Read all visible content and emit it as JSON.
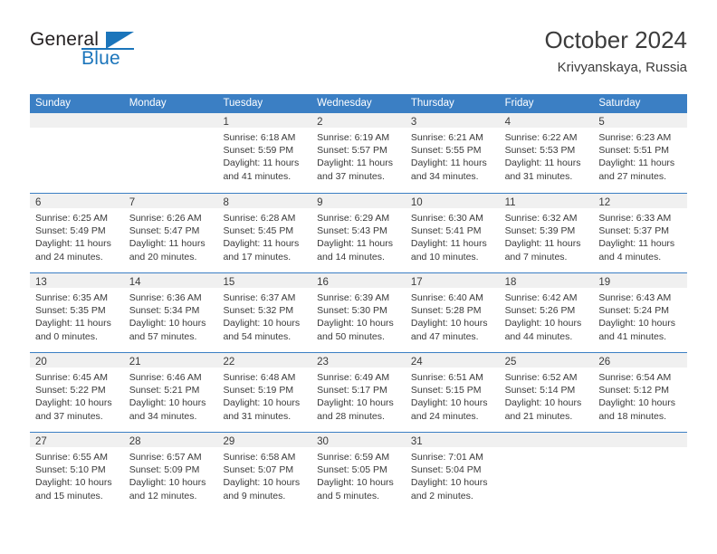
{
  "brand": {
    "line1": "General",
    "line2": "Blue",
    "accent_color": "#1b75bb"
  },
  "header": {
    "title": "October 2024",
    "location": "Krivyanskaya, Russia"
  },
  "calendar": {
    "header_color": "#3b7fc4",
    "daynum_band_color": "#f0f0f0",
    "weekday_headers": [
      "Sunday",
      "Monday",
      "Tuesday",
      "Wednesday",
      "Thursday",
      "Friday",
      "Saturday"
    ],
    "weeks": [
      [
        {
          "day": "",
          "lines": []
        },
        {
          "day": "",
          "lines": []
        },
        {
          "day": "1",
          "lines": [
            "Sunrise: 6:18 AM",
            "Sunset: 5:59 PM",
            "Daylight: 11 hours",
            "and 41 minutes."
          ]
        },
        {
          "day": "2",
          "lines": [
            "Sunrise: 6:19 AM",
            "Sunset: 5:57 PM",
            "Daylight: 11 hours",
            "and 37 minutes."
          ]
        },
        {
          "day": "3",
          "lines": [
            "Sunrise: 6:21 AM",
            "Sunset: 5:55 PM",
            "Daylight: 11 hours",
            "and 34 minutes."
          ]
        },
        {
          "day": "4",
          "lines": [
            "Sunrise: 6:22 AM",
            "Sunset: 5:53 PM",
            "Daylight: 11 hours",
            "and 31 minutes."
          ]
        },
        {
          "day": "5",
          "lines": [
            "Sunrise: 6:23 AM",
            "Sunset: 5:51 PM",
            "Daylight: 11 hours",
            "and 27 minutes."
          ]
        }
      ],
      [
        {
          "day": "6",
          "lines": [
            "Sunrise: 6:25 AM",
            "Sunset: 5:49 PM",
            "Daylight: 11 hours",
            "and 24 minutes."
          ]
        },
        {
          "day": "7",
          "lines": [
            "Sunrise: 6:26 AM",
            "Sunset: 5:47 PM",
            "Daylight: 11 hours",
            "and 20 minutes."
          ]
        },
        {
          "day": "8",
          "lines": [
            "Sunrise: 6:28 AM",
            "Sunset: 5:45 PM",
            "Daylight: 11 hours",
            "and 17 minutes."
          ]
        },
        {
          "day": "9",
          "lines": [
            "Sunrise: 6:29 AM",
            "Sunset: 5:43 PM",
            "Daylight: 11 hours",
            "and 14 minutes."
          ]
        },
        {
          "day": "10",
          "lines": [
            "Sunrise: 6:30 AM",
            "Sunset: 5:41 PM",
            "Daylight: 11 hours",
            "and 10 minutes."
          ]
        },
        {
          "day": "11",
          "lines": [
            "Sunrise: 6:32 AM",
            "Sunset: 5:39 PM",
            "Daylight: 11 hours",
            "and 7 minutes."
          ]
        },
        {
          "day": "12",
          "lines": [
            "Sunrise: 6:33 AM",
            "Sunset: 5:37 PM",
            "Daylight: 11 hours",
            "and 4 minutes."
          ]
        }
      ],
      [
        {
          "day": "13",
          "lines": [
            "Sunrise: 6:35 AM",
            "Sunset: 5:35 PM",
            "Daylight: 11 hours",
            "and 0 minutes."
          ]
        },
        {
          "day": "14",
          "lines": [
            "Sunrise: 6:36 AM",
            "Sunset: 5:34 PM",
            "Daylight: 10 hours",
            "and 57 minutes."
          ]
        },
        {
          "day": "15",
          "lines": [
            "Sunrise: 6:37 AM",
            "Sunset: 5:32 PM",
            "Daylight: 10 hours",
            "and 54 minutes."
          ]
        },
        {
          "day": "16",
          "lines": [
            "Sunrise: 6:39 AM",
            "Sunset: 5:30 PM",
            "Daylight: 10 hours",
            "and 50 minutes."
          ]
        },
        {
          "day": "17",
          "lines": [
            "Sunrise: 6:40 AM",
            "Sunset: 5:28 PM",
            "Daylight: 10 hours",
            "and 47 minutes."
          ]
        },
        {
          "day": "18",
          "lines": [
            "Sunrise: 6:42 AM",
            "Sunset: 5:26 PM",
            "Daylight: 10 hours",
            "and 44 minutes."
          ]
        },
        {
          "day": "19",
          "lines": [
            "Sunrise: 6:43 AM",
            "Sunset: 5:24 PM",
            "Daylight: 10 hours",
            "and 41 minutes."
          ]
        }
      ],
      [
        {
          "day": "20",
          "lines": [
            "Sunrise: 6:45 AM",
            "Sunset: 5:22 PM",
            "Daylight: 10 hours",
            "and 37 minutes."
          ]
        },
        {
          "day": "21",
          "lines": [
            "Sunrise: 6:46 AM",
            "Sunset: 5:21 PM",
            "Daylight: 10 hours",
            "and 34 minutes."
          ]
        },
        {
          "day": "22",
          "lines": [
            "Sunrise: 6:48 AM",
            "Sunset: 5:19 PM",
            "Daylight: 10 hours",
            "and 31 minutes."
          ]
        },
        {
          "day": "23",
          "lines": [
            "Sunrise: 6:49 AM",
            "Sunset: 5:17 PM",
            "Daylight: 10 hours",
            "and 28 minutes."
          ]
        },
        {
          "day": "24",
          "lines": [
            "Sunrise: 6:51 AM",
            "Sunset: 5:15 PM",
            "Daylight: 10 hours",
            "and 24 minutes."
          ]
        },
        {
          "day": "25",
          "lines": [
            "Sunrise: 6:52 AM",
            "Sunset: 5:14 PM",
            "Daylight: 10 hours",
            "and 21 minutes."
          ]
        },
        {
          "day": "26",
          "lines": [
            "Sunrise: 6:54 AM",
            "Sunset: 5:12 PM",
            "Daylight: 10 hours",
            "and 18 minutes."
          ]
        }
      ],
      [
        {
          "day": "27",
          "lines": [
            "Sunrise: 6:55 AM",
            "Sunset: 5:10 PM",
            "Daylight: 10 hours",
            "and 15 minutes."
          ]
        },
        {
          "day": "28",
          "lines": [
            "Sunrise: 6:57 AM",
            "Sunset: 5:09 PM",
            "Daylight: 10 hours",
            "and 12 minutes."
          ]
        },
        {
          "day": "29",
          "lines": [
            "Sunrise: 6:58 AM",
            "Sunset: 5:07 PM",
            "Daylight: 10 hours",
            "and 9 minutes."
          ]
        },
        {
          "day": "30",
          "lines": [
            "Sunrise: 6:59 AM",
            "Sunset: 5:05 PM",
            "Daylight: 10 hours",
            "and 5 minutes."
          ]
        },
        {
          "day": "31",
          "lines": [
            "Sunrise: 7:01 AM",
            "Sunset: 5:04 PM",
            "Daylight: 10 hours",
            "and 2 minutes."
          ]
        },
        {
          "day": "",
          "lines": []
        },
        {
          "day": "",
          "lines": []
        }
      ]
    ]
  }
}
